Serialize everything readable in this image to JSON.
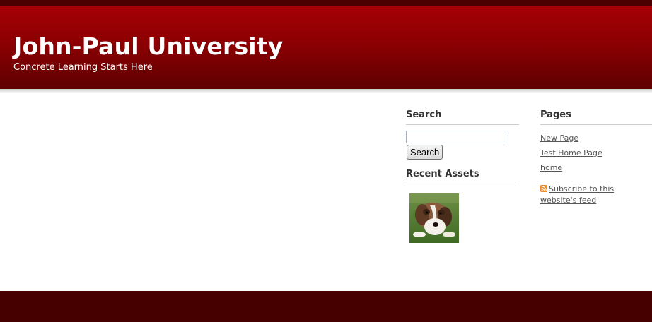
{
  "header": {
    "title": "John-Paul University",
    "tagline": "Concrete Learning Starts Here"
  },
  "search": {
    "heading": "Search",
    "input_value": "",
    "button_label": "Search"
  },
  "recent_assets": {
    "heading": "Recent Assets",
    "items": [
      {
        "icon": "puppy-photo"
      }
    ]
  },
  "pages": {
    "heading": "Pages",
    "items": [
      {
        "label": "New Page"
      },
      {
        "label": "Test Home Page"
      },
      {
        "label": "home"
      }
    ]
  },
  "feed": {
    "icon": "rss-icon",
    "label": "Subscribe to this website's feed"
  },
  "colors": {
    "header_top": "#a40004",
    "header_bottom": "#5e0000",
    "footer": "#460000",
    "link": "#555555"
  }
}
